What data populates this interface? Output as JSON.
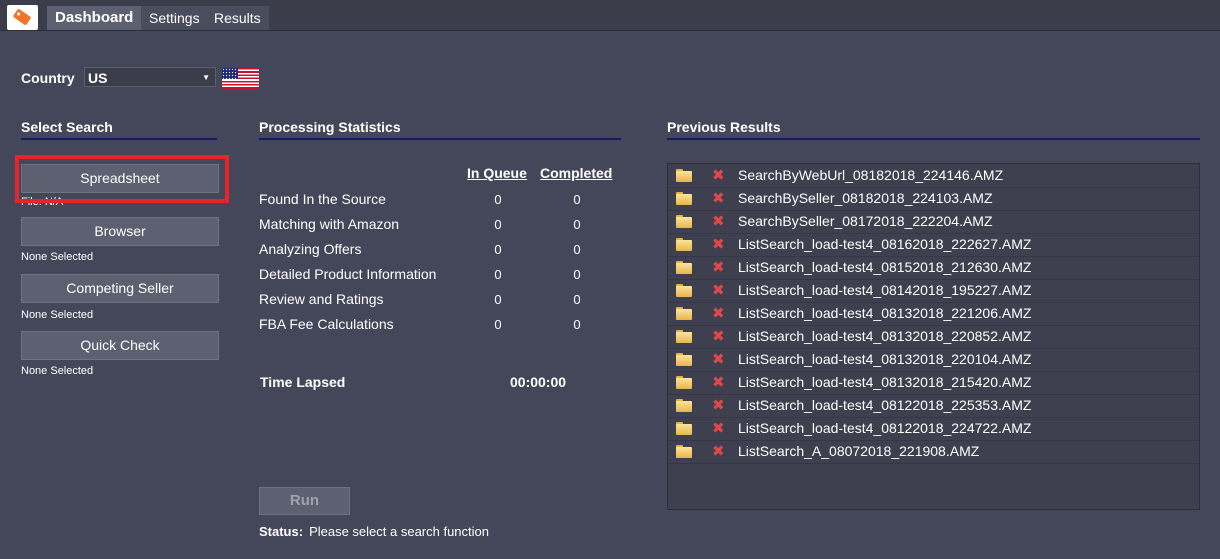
{
  "app": {
    "logo_icon": "tag-icon"
  },
  "tabs": [
    "Dashboard",
    "Settings",
    "Results"
  ],
  "country": {
    "label": "Country",
    "selected": "US",
    "flag_icon": "us-flag-icon"
  },
  "select_search": {
    "title": "Select Search",
    "buttons": [
      {
        "label": "Spreadsheet",
        "note": "File: N/A"
      },
      {
        "label": "Browser",
        "note": "None Selected"
      },
      {
        "label": "Competing Seller",
        "note": "None Selected"
      },
      {
        "label": "Quick Check",
        "note": "None Selected"
      }
    ]
  },
  "stats": {
    "title": "Processing Statistics",
    "col_queue": "In Queue",
    "col_completed": "Completed",
    "rows": [
      {
        "label": "Found In the Source",
        "queue": "0",
        "completed": "0"
      },
      {
        "label": "Matching with Amazon",
        "queue": "0",
        "completed": "0"
      },
      {
        "label": "Analyzing Offers",
        "queue": "0",
        "completed": "0"
      },
      {
        "label": "Detailed Product Information",
        "queue": "0",
        "completed": "0"
      },
      {
        "label": "Review and Ratings",
        "queue": "0",
        "completed": "0"
      },
      {
        "label": "FBA Fee Calculations",
        "queue": "0",
        "completed": "0"
      }
    ],
    "time_label": "Time Lapsed",
    "time_value": "00:00:00"
  },
  "run": {
    "label": "Run"
  },
  "status": {
    "label": "Status:",
    "text": "Please select a search function"
  },
  "previous": {
    "title": "Previous Results",
    "files": [
      "SearchByWebUrl_08182018_224146.AMZ",
      "SearchBySeller_08182018_224103.AMZ",
      "SearchBySeller_08172018_222204.AMZ",
      "ListSearch_load-test4_08162018_222627.AMZ",
      "ListSearch_load-test4_08152018_212630.AMZ",
      "ListSearch_load-test4_08142018_195227.AMZ",
      "ListSearch_load-test4_08132018_221206.AMZ",
      "ListSearch_load-test4_08132018_220852.AMZ",
      "ListSearch_load-test4_08132018_220104.AMZ",
      "ListSearch_load-test4_08132018_215420.AMZ",
      "ListSearch_load-test4_08122018_225353.AMZ",
      "ListSearch_load-test4_08122018_224722.AMZ",
      "ListSearch_A_08072018_221908.AMZ"
    ]
  }
}
